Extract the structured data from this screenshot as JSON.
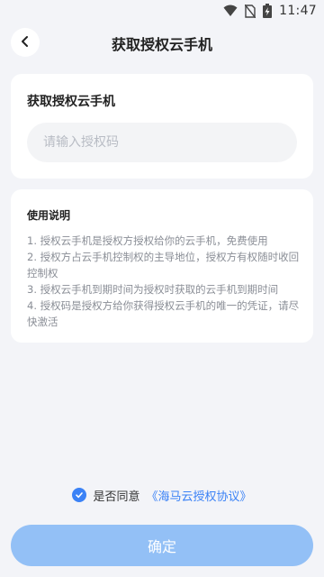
{
  "status_bar": {
    "time": "11:47",
    "icons": [
      "wifi-icon",
      "no-sim-icon",
      "battery-charging-icon"
    ]
  },
  "header": {
    "back_icon": "chevron-left-icon",
    "title": "获取授权云手机"
  },
  "authorization_card": {
    "title": "获取授权云手机",
    "input": {
      "value": "",
      "placeholder": "请输入授权码"
    }
  },
  "instructions": {
    "title": "使用说明",
    "items": [
      "1. 授权云手机是授权方授权给你的云手机，免费使用",
      "2. 授权方占云手机控制权的主导地位，授权方有权随时收回控制权",
      "3. 授权云手机到期时间为授权时获取的云手机到期时间",
      "4. 授权码是授权方给你获得授权云手机的唯一的凭证，请尽快激活"
    ]
  },
  "agreement": {
    "checked": true,
    "label": "是否同意",
    "link_text": "《海马云授权协议》"
  },
  "confirm_button": {
    "label": "确定"
  },
  "colors": {
    "accent": "#3b82f6",
    "button_disabled": "#93c0f6",
    "background": "#f3f4f8"
  }
}
